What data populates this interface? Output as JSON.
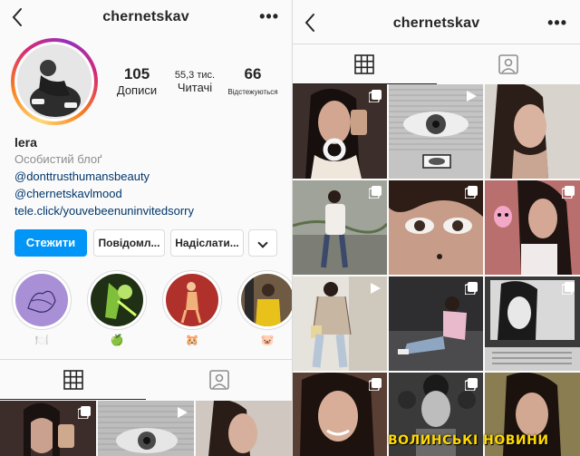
{
  "left_screen": {
    "username": "chernetskav",
    "more_label": "•••",
    "stats": [
      {
        "value": "105",
        "label": "Дописи"
      },
      {
        "value": "55,3 тис.",
        "label": "Читачі"
      },
      {
        "value": "66",
        "label": "Відстежуються"
      }
    ],
    "bio": {
      "name": "lera",
      "category": "Особистий блоґ",
      "links": [
        "@donttrusthumansbeauty",
        "@chernetskavlmood",
        "tele.click/youvebeenuninvitedsorry"
      ]
    },
    "buttons": {
      "follow": "Стежити",
      "message": "Повідомл...",
      "email": "Надіслати..."
    },
    "highlights": [
      {
        "label": "🍽️",
        "color": "#a88fd6"
      },
      {
        "label": "🍏",
        "color": "#3b5a2b"
      },
      {
        "label": "🐹",
        "color": "#b0302b"
      },
      {
        "label": "🐷",
        "color": "#6f5a44"
      }
    ],
    "tabs": [
      {
        "icon": "grid-icon",
        "active": true
      },
      {
        "icon": "tagged-icon",
        "active": false
      }
    ]
  },
  "right_screen": {
    "username": "chernetskav",
    "more_label": "•••",
    "tabs": [
      {
        "icon": "grid-icon",
        "active": true
      },
      {
        "icon": "tagged-icon",
        "active": false
      }
    ],
    "watermark": "ВОЛИНСЬКІ НОВИНИ"
  },
  "colors": {
    "accent": "#0095f6",
    "link": "#00376b",
    "muted": "#8e8e8e",
    "border": "#dbdbdb"
  }
}
